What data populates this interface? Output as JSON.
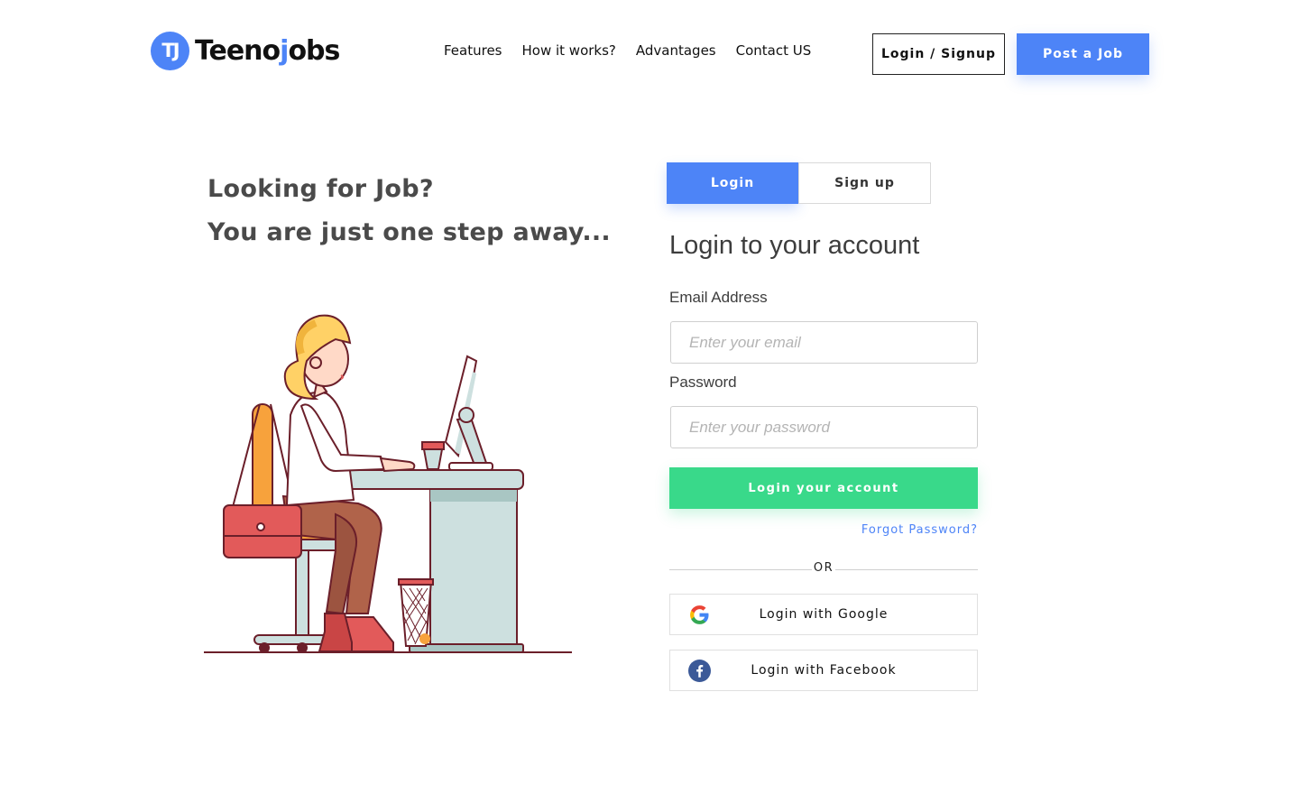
{
  "brand": {
    "badge": "TJ",
    "name_part1": "Teeno",
    "name_accent": "j",
    "name_part2": "obs",
    "accent_color": "#4d84f7"
  },
  "nav": {
    "items": [
      "Features",
      "How it works?",
      "Advantages",
      "Contact US"
    ]
  },
  "header_buttons": {
    "login_signup": "Login / Signup",
    "post_job": "Post a Job"
  },
  "hero": {
    "line1": "Looking for Job?",
    "line2": "You are just one step away..."
  },
  "tabs": {
    "login": "Login",
    "signup": "Sign up",
    "active": "login"
  },
  "form": {
    "title": "Login to your account",
    "email_label": "Email Address",
    "email_placeholder": "Enter your email",
    "email_value": "",
    "password_label": "Password",
    "password_placeholder": "Enter your password",
    "password_value": "",
    "submit_label": "Login your account",
    "forgot_label": "Forgot Password?",
    "or_label": "OR",
    "google_label": "Login with Google",
    "facebook_label": "Login with Facebook"
  },
  "colors": {
    "primary": "#4d84f7",
    "success": "#39d98a",
    "text": "#3d3d3d"
  }
}
